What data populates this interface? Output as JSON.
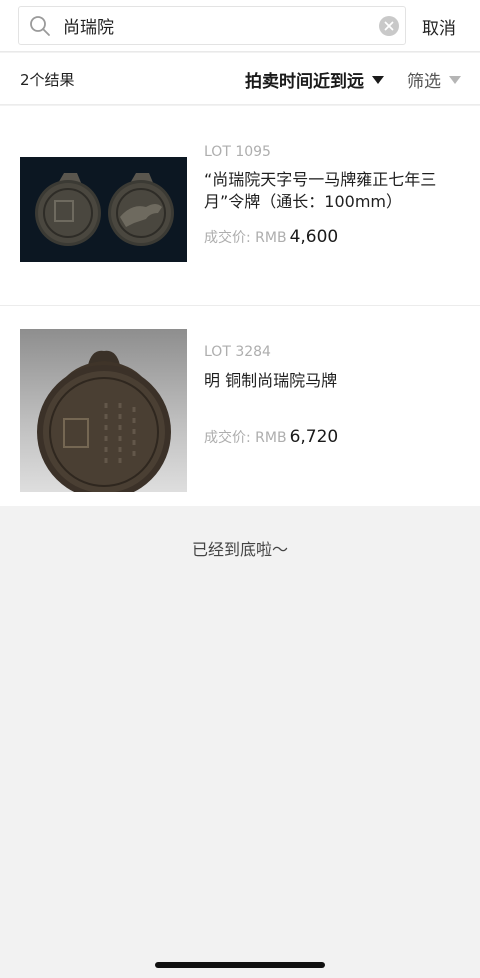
{
  "search": {
    "value": "尚瑞院",
    "cancel_label": "取消"
  },
  "filterbar": {
    "count_label": "2个结果",
    "sort_label": "拍卖时间近到远",
    "filter_label": "筛选"
  },
  "results": [
    {
      "lot": "LOT 1095",
      "title": "“尚瑞院天字号一马牌雍正七年三月”令牌（通长：100mm）",
      "price_label": "成交价: RMB",
      "price": "4,600"
    },
    {
      "lot": "LOT 3284",
      "title": "明  铜制尚瑞院马牌",
      "price_label": "成交价: RMB",
      "price": "6,720"
    }
  ],
  "end_note": "已经到底啦～",
  "icons": {
    "search": "search-icon",
    "clear": "clear-icon",
    "sort": "caret-down-icon",
    "filter": "caret-down-icon"
  },
  "colors": {
    "muted": "#aeaeae",
    "text": "#1f1f1f",
    "background": "#f2f2f2"
  }
}
